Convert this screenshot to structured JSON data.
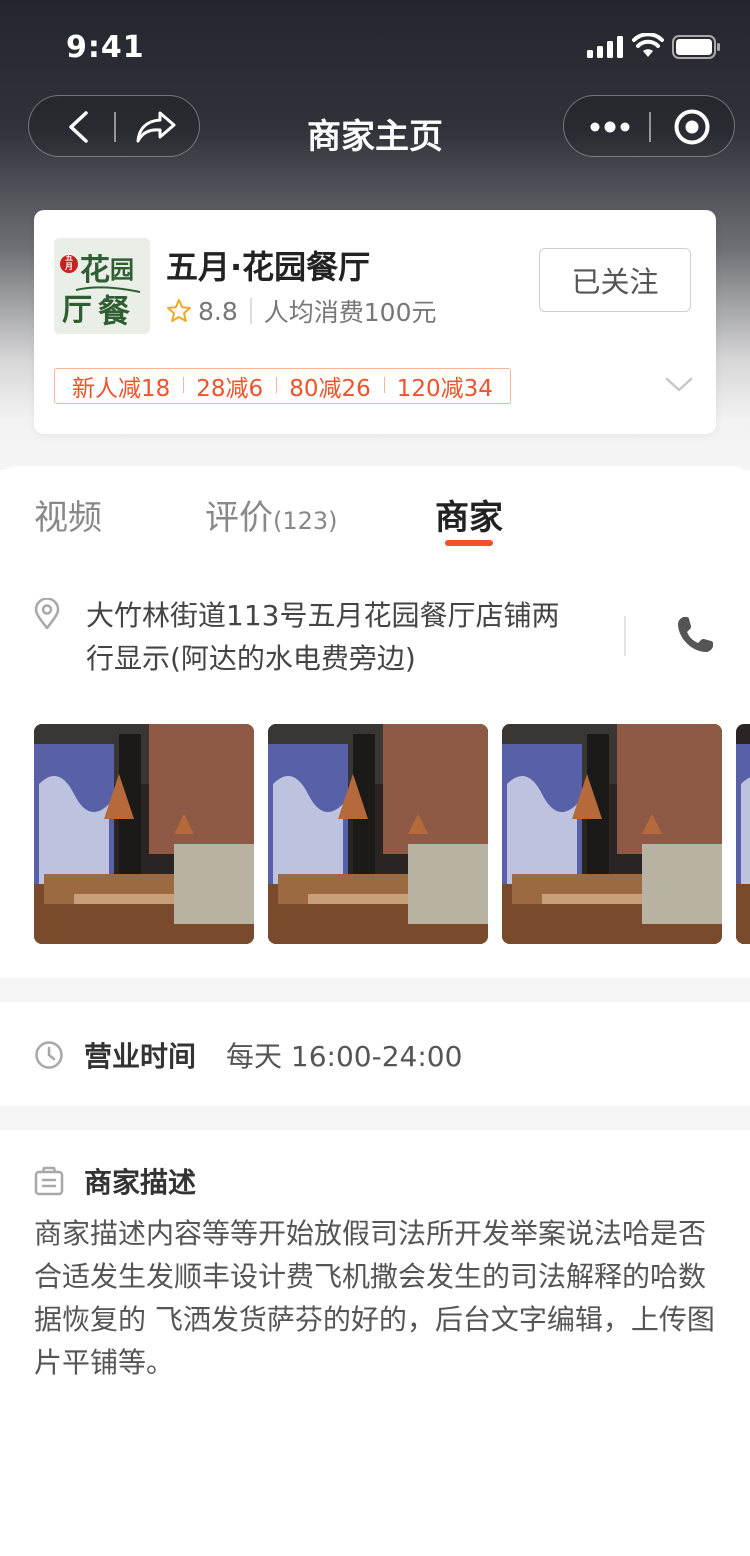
{
  "status_bar": {
    "time": "9:41"
  },
  "nav": {
    "title": "商家主页"
  },
  "shop": {
    "name": "五月·花园餐厅",
    "logo_text_big": "花园",
    "logo_text_big2": "厅餐",
    "logo_badge": "五月",
    "rating": "8.8",
    "avg_spend": "人均消费100元",
    "follow_label": "已关注",
    "promos": [
      "新人减18",
      "28减6",
      "80减26",
      "120减34"
    ]
  },
  "tabs": [
    {
      "label": "视频",
      "count": ""
    },
    {
      "label": "评价",
      "count": "(123)"
    },
    {
      "label": "商家",
      "count": ""
    }
  ],
  "address": {
    "text": "大竹林街道113号五月花园餐厅店铺两行显示(阿达的水电费旁边)"
  },
  "photos_count": 4,
  "hours": {
    "label": "营业时间",
    "value": "每天 16:00-24:00"
  },
  "description": {
    "label": "商家描述",
    "text": "商家描述内容等等开始放假司法所开发举案说法哈是否合适发生发顺丰设计费飞机撒会发生的司法解释的哈数据恢复的 飞洒发货萨芬的好的，后台文字编辑，上传图片平铺等。"
  },
  "colors": {
    "accent": "#f0532b",
    "promo_border": "#f7b49a"
  }
}
